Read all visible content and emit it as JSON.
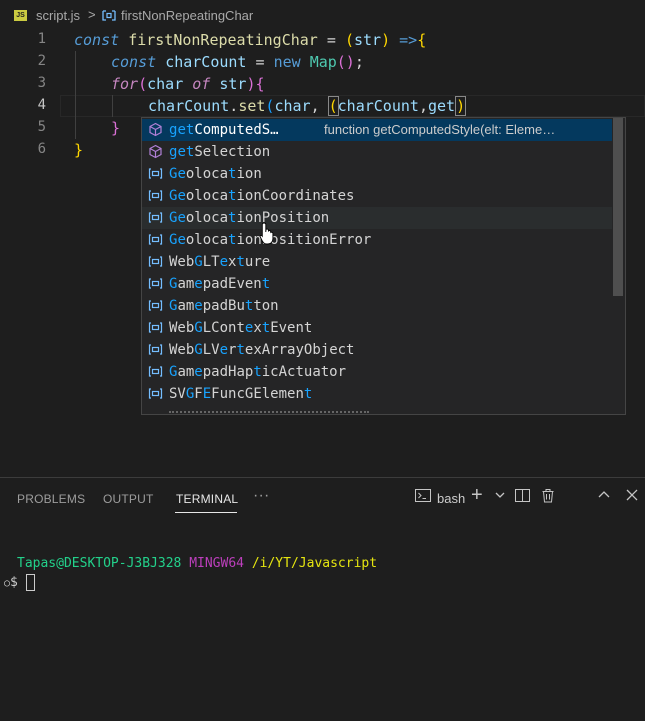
{
  "breadcrumb": {
    "file_icon": "JS",
    "file": "script.js",
    "separator": ">",
    "symbol_icon": "symbol-method-icon",
    "symbol": "firstNonRepeatingChar"
  },
  "editor": {
    "line_numbers": [
      "1",
      "2",
      "3",
      "4",
      "5",
      "6"
    ],
    "active_line": "4",
    "code": {
      "l1": {
        "kw": "const",
        "name": "firstNonRepeatingChar",
        "eq": " = ",
        "p1": "(",
        "arg": "str",
        "p2": ")",
        "arrow": " =>",
        "b": "{"
      },
      "l2": {
        "kw": "const",
        "name": "charCount",
        "eq": " = ",
        "new": "new",
        "cls": "Map",
        "call": "()",
        "semi": ";"
      },
      "l3": {
        "kw": "for",
        "p1": "(",
        "v1": "char",
        "of": " of ",
        "v2": "str",
        "p2": ")",
        "b": "{"
      },
      "l4": {
        "obj": "charCount",
        "dot": ".",
        "fn": "set",
        "p1": "(",
        "v1": "char",
        "comma": ", ",
        "p2": "(",
        "v2": "charCount",
        "comma2": ",",
        "v3": "get",
        "p3": ")"
      },
      "l5": {
        "b": "}"
      },
      "l6": {
        "b": "}"
      }
    }
  },
  "suggestions": {
    "selected_detail": "function getComputedStyle(elt: Eleme…",
    "items": [
      {
        "icon": "method-icon",
        "label": "getComputedS…"
      },
      {
        "icon": "method-icon",
        "label": "getSelection"
      },
      {
        "icon": "variable-icon",
        "label": "Geolocation"
      },
      {
        "icon": "variable-icon",
        "label": "GeolocationCoordinates"
      },
      {
        "icon": "variable-icon",
        "label": "GeolocationPosition"
      },
      {
        "icon": "variable-icon",
        "label": "GeolocationPositionError"
      },
      {
        "icon": "variable-icon",
        "label": "WebGLTexture"
      },
      {
        "icon": "variable-icon",
        "label": "GamepadEvent"
      },
      {
        "icon": "variable-icon",
        "label": "GamepadButton"
      },
      {
        "icon": "variable-icon",
        "label": "WebGLContextEvent"
      },
      {
        "icon": "variable-icon",
        "label": "WebGLVertexArrayObject"
      },
      {
        "icon": "variable-icon",
        "label": "GamepadHapticActuator"
      },
      {
        "icon": "variable-icon",
        "label": "SVGFEFuncGElement"
      }
    ]
  },
  "panel": {
    "tabs": [
      "PROBLEMS",
      "OUTPUT",
      "TERMINAL"
    ],
    "active_tab": "TERMINAL",
    "more": "···",
    "shell": "bash",
    "terminal": {
      "user_host": "Tapas@DESKTOP-J3BJ328",
      "env": "MINGW64",
      "path": "/i/YT/Javascript",
      "prompt": "$"
    }
  },
  "colors": {
    "accent": "#18a3ff",
    "selection": "#04395e",
    "background": "#1e1e1e"
  }
}
